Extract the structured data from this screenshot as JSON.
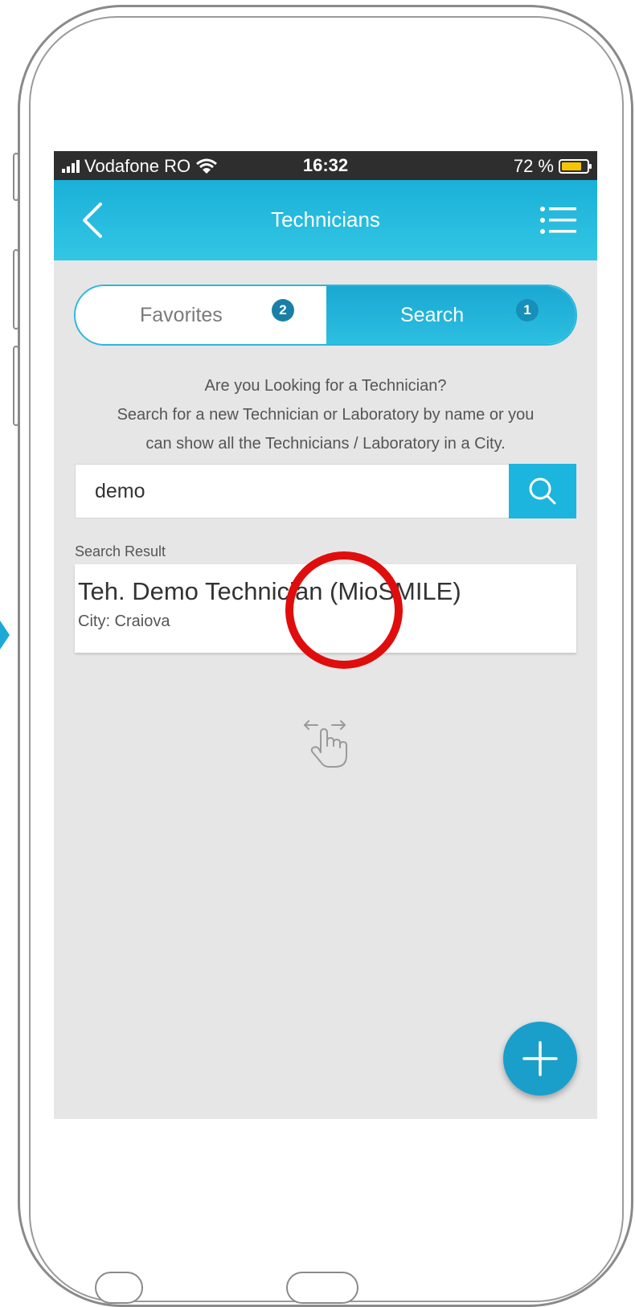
{
  "status_bar": {
    "carrier": "Vodafone RO",
    "time": "16:32",
    "battery": "72 %"
  },
  "nav": {
    "title": "Technicians"
  },
  "tabs": {
    "favorites_label": "Favorites",
    "favorites_count": "2",
    "search_label": "Search",
    "search_count": "1",
    "active": "Search"
  },
  "intro": {
    "line1": "Are you Looking for a Technician?",
    "line2": "Search for a new Technician or Laboratory by name or you",
    "line3": "can show all the Technicians / Laboratory in a City."
  },
  "search": {
    "value": "demo"
  },
  "results": {
    "label": "Search Result",
    "items": [
      {
        "name": "Teh. Demo Technician (MioSMILE)",
        "city": "City: Craiova"
      }
    ]
  },
  "icons": {
    "back": "back-chevron-icon",
    "menu": "list-menu-icon",
    "search": "search-icon",
    "swipe": "swipe-hand-icon",
    "add": "plus-icon"
  },
  "colors": {
    "accent": "#1ab0d8",
    "badge": "#1a7fa7",
    "fab": "#1a9fcb",
    "annotation": "#e00d0d"
  }
}
